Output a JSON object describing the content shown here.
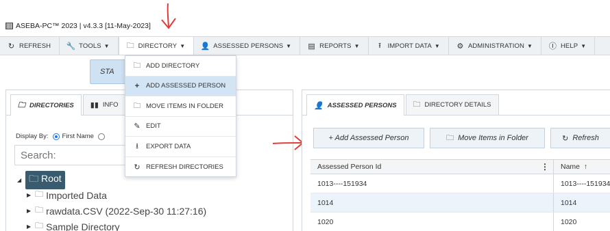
{
  "app": {
    "title": "ASEBA-PC™ 2023 | v4.3.3 [11-May-2023]"
  },
  "menubar": [
    {
      "icon": "refresh-icon",
      "label": "REFRESH",
      "caret": false
    },
    {
      "icon": "wrench-icon",
      "label": "TOOLS",
      "caret": true
    },
    {
      "icon": "folder-icon",
      "label": "DIRECTORY",
      "caret": true
    },
    {
      "icon": "person-icon",
      "label": "ASSESSED PERSONS",
      "caret": true
    },
    {
      "icon": "report-icon",
      "label": "REPORTS",
      "caret": true
    },
    {
      "icon": "upload-icon",
      "label": "IMPORT DATA",
      "caret": true
    },
    {
      "icon": "gear-icon",
      "label": "ADMINISTRATION",
      "caret": true
    },
    {
      "icon": "help-icon",
      "label": "HELP",
      "caret": true
    }
  ],
  "start_button": {
    "label": "STA"
  },
  "directory_menu": [
    {
      "icon": "add-folder-icon",
      "label": "ADD DIRECTORY"
    },
    {
      "icon": "plus-icon",
      "label": "ADD ASSESSED PERSON"
    },
    {
      "icon": "move-folder-icon",
      "label": "MOVE ITEMS IN FOLDER"
    },
    {
      "icon": "pencil-icon",
      "label": "EDIT"
    },
    {
      "icon": "download-icon",
      "label": "EXPORT DATA"
    },
    {
      "icon": "refresh-icon",
      "label": "REFRESH DIRECTORIES"
    }
  ],
  "left_panel": {
    "tabs": [
      {
        "icon": "folder-icon",
        "label": "DIRECTORIES"
      },
      {
        "icon": "info-icon",
        "label": "INFO"
      }
    ],
    "display_by_label": "Display By:",
    "display_by_selected": "First Name",
    "search_placeholder": "Search:",
    "tree": {
      "root": "Root",
      "children": [
        "Imported Data",
        "rawdata.CSV (2022-Sep-30 11:27:16)",
        "Sample Directory"
      ]
    }
  },
  "right_panel": {
    "tabs": [
      {
        "icon": "person-icon",
        "label": "ASSESSED PERSONS"
      },
      {
        "icon": "folder-icon",
        "label": "DIRECTORY DETAILS"
      }
    ],
    "buttons": [
      {
        "icon": "plus-icon",
        "label": "+ Add Assessed Person"
      },
      {
        "icon": "move-folder-icon",
        "label": "Move Items in Folder"
      },
      {
        "icon": "refresh-icon",
        "label": "Refresh"
      }
    ],
    "grid": {
      "columns": [
        "Assessed Person Id",
        "Name"
      ],
      "sort_indicator": "↑",
      "rows": [
        [
          "1013----151934",
          "1013----151934"
        ],
        [
          "1014",
          "1014"
        ],
        [
          "1020",
          "1020"
        ]
      ]
    }
  },
  "colors": {
    "menubar_bg": "#eef1f4",
    "accent": "#1a73e8",
    "highlight": "#d3e4f5",
    "annotation": "#e53935"
  }
}
